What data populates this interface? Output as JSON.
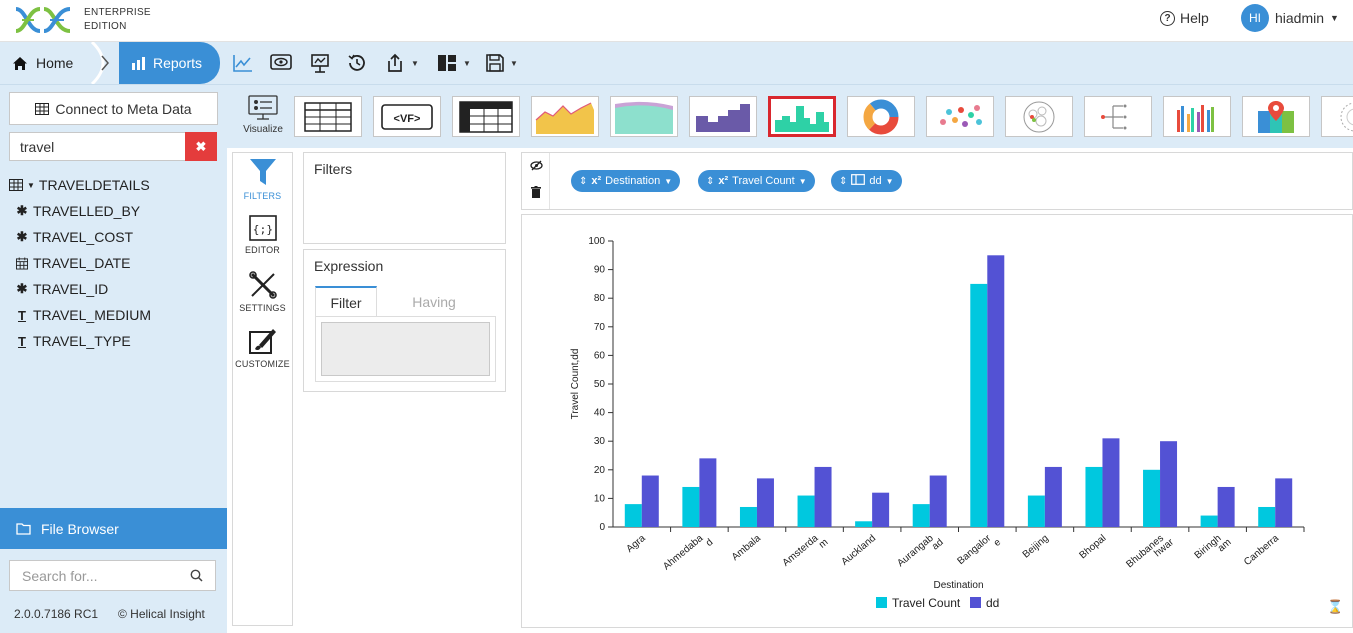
{
  "header": {
    "edition_line1": "ENTERPRISE",
    "edition_line2": "EDITION",
    "help": "Help",
    "avatar_initials": "HI",
    "username": "hiadmin"
  },
  "breadcrumb": {
    "home": "Home",
    "reports": "Reports"
  },
  "sidebar": {
    "connect_button": "Connect to Meta Data",
    "search_value": "travel",
    "table_name": "TRAVELDETAILS",
    "fields": [
      {
        "name": "TRAVELLED_BY",
        "icon": "gear-icon"
      },
      {
        "name": "TRAVEL_COST",
        "icon": "gear-icon"
      },
      {
        "name": "TRAVEL_DATE",
        "icon": "calendar-icon"
      },
      {
        "name": "TRAVEL_ID",
        "icon": "gear-icon"
      },
      {
        "name": "TRAVEL_MEDIUM",
        "icon": "text-icon"
      },
      {
        "name": "TRAVEL_TYPE",
        "icon": "text-icon"
      }
    ],
    "file_browser": "File Browser",
    "file_search_placeholder": "Search for...",
    "version": "2.0.0.7186 RC1",
    "copyright": "© Helical Insight"
  },
  "visualize": {
    "label": "Visualize",
    "selected": "histogram"
  },
  "side_tabs": {
    "filters": "FILTERS",
    "editor": "EDITOR",
    "settings": "SETTINGS",
    "customize": "CUSTOMIZE"
  },
  "panels": {
    "filters_title": "Filters",
    "expression_title": "Expression",
    "tab_filter": "Filter",
    "tab_having": "Having"
  },
  "field_pills": [
    {
      "sup": "x²",
      "label": "Destination"
    },
    {
      "sup": "x²",
      "label": "Travel Count"
    },
    {
      "sup": "",
      "label": "dd"
    }
  ],
  "colors": {
    "accent": "#3a8fd6",
    "series1": "#00c8df",
    "series2": "#5352d4",
    "clear": "#e43c3c"
  },
  "chart_data": {
    "type": "bar",
    "categories": [
      "Agra",
      "Ahmedabad",
      "Ambala",
      "Amsterdam",
      "Auckland",
      "Aurangabad",
      "Bangalore",
      "Beijing",
      "Bhopal",
      "Bhubaneshwar",
      "Birmingham",
      "Canberra"
    ],
    "category_labels": [
      [
        "Agra"
      ],
      [
        "Ahmedaba",
        "d"
      ],
      [
        "Ambala"
      ],
      [
        "Amsterda",
        "m"
      ],
      [
        "Auckland"
      ],
      [
        "Aurangab",
        "ad"
      ],
      [
        "Bangalor",
        "e"
      ],
      [
        "Beijing"
      ],
      [
        "Bhopal"
      ],
      [
        "Bhubanes",
        "hwar"
      ],
      [
        "Biringh",
        "am"
      ],
      [
        "Canberra"
      ]
    ],
    "series": [
      {
        "name": "Travel Count",
        "values": [
          8,
          14,
          7,
          11,
          2,
          8,
          85,
          11,
          21,
          20,
          4,
          7
        ]
      },
      {
        "name": "dd",
        "values": [
          18,
          24,
          17,
          21,
          12,
          18,
          95,
          21,
          31,
          30,
          14,
          17
        ]
      }
    ],
    "xlabel": "Destination",
    "ylabel": "Travel Count,dd",
    "ylim": [
      0,
      100
    ],
    "yticks": [
      0,
      10,
      20,
      30,
      40,
      50,
      60,
      70,
      80,
      90,
      100
    ],
    "legend": "bottom-center",
    "grid": false
  }
}
